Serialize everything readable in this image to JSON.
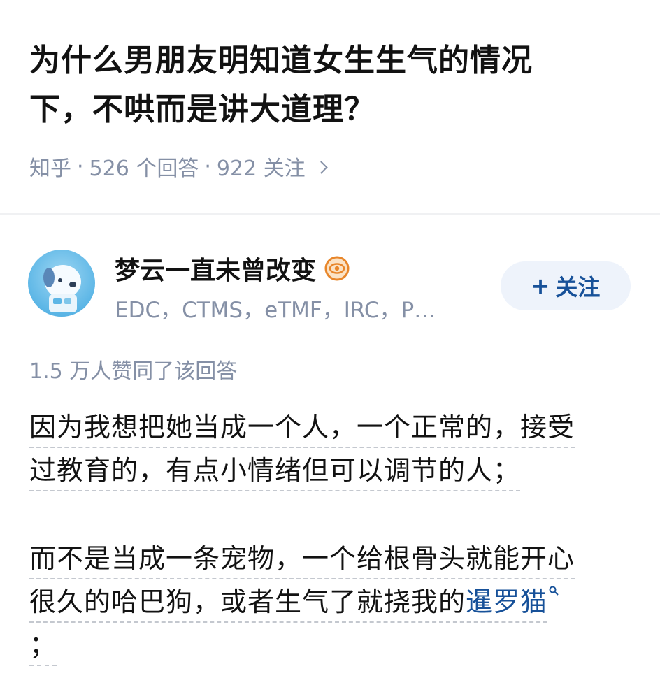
{
  "question": {
    "title_line1": "为什么男朋友明知道女生生气的情况",
    "title_line2": "下，不哄而是讲大道理？",
    "source": "知乎",
    "answers": "526 个回答",
    "follows": "922 关注",
    "separator": "·"
  },
  "author": {
    "name": "梦云一直未曾改变",
    "bio": "EDC，CTMS，eTMF，IRC，P…",
    "follow_label": "关注",
    "follow_plus": "+"
  },
  "answer": {
    "votes": "1.5 万人赞同了该回答",
    "p1_line1": "因为我想把她当成一个人，一个正常的，接受",
    "p1_line2": "过教育的，有点小情绪但可以调节的人；",
    "p2_line1": "而不是当成一条宠物，一个给根骨头就能开心",
    "p2_line2_prefix": "很久的哈巴狗，或者生气了就挠我的",
    "p2_link": "暹罗猫",
    "p2_line3": "；"
  },
  "colors": {
    "accent": "#175199",
    "meta_gray": "#8590a6",
    "follow_bg": "#eef3fb",
    "badge_orange": "#e8862a"
  },
  "icons": {
    "badge": "orange-eye-badge-icon",
    "link_search": "search-icon",
    "chevron": "chevron-right-icon"
  }
}
